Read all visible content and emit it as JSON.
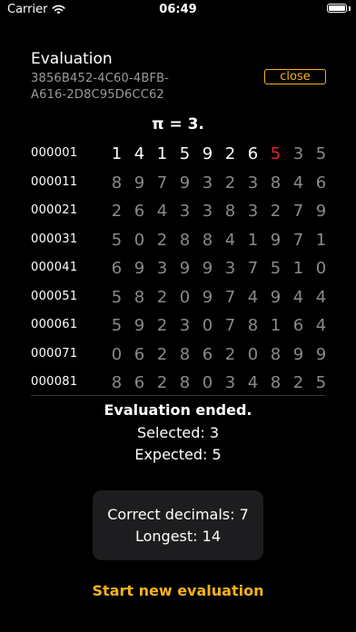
{
  "status_bar": {
    "carrier": "Carrier",
    "time": "06:49"
  },
  "header": {
    "title": "Evaluation",
    "evaluation_id": "3856B452-4C60-4BFB-A616-2D8C95D6CC62",
    "close_label": "close"
  },
  "pi_prefix": "π = 3.",
  "grid": {
    "rows": [
      {
        "label": "000001",
        "digits": [
          "1",
          "4",
          "1",
          "5",
          "9",
          "2",
          "6",
          "5",
          "3",
          "5"
        ]
      },
      {
        "label": "000011",
        "digits": [
          "8",
          "9",
          "7",
          "9",
          "3",
          "2",
          "3",
          "8",
          "4",
          "6"
        ]
      },
      {
        "label": "000021",
        "digits": [
          "2",
          "6",
          "4",
          "3",
          "3",
          "8",
          "3",
          "2",
          "7",
          "9"
        ]
      },
      {
        "label": "000031",
        "digits": [
          "5",
          "0",
          "2",
          "8",
          "8",
          "4",
          "1",
          "9",
          "7",
          "1"
        ]
      },
      {
        "label": "000041",
        "digits": [
          "6",
          "9",
          "3",
          "9",
          "9",
          "3",
          "7",
          "5",
          "1",
          "0"
        ]
      },
      {
        "label": "000051",
        "digits": [
          "5",
          "8",
          "2",
          "0",
          "9",
          "7",
          "4",
          "9",
          "4",
          "4"
        ]
      },
      {
        "label": "000061",
        "digits": [
          "5",
          "9",
          "2",
          "3",
          "0",
          "7",
          "8",
          "1",
          "6",
          "4"
        ]
      },
      {
        "label": "000071",
        "digits": [
          "0",
          "6",
          "2",
          "8",
          "6",
          "2",
          "0",
          "8",
          "9",
          "9"
        ]
      },
      {
        "label": "000081",
        "digits": [
          "8",
          "6",
          "2",
          "8",
          "0",
          "3",
          "4",
          "8",
          "2",
          "5"
        ]
      }
    ],
    "correct_count": 7,
    "wrong_index": 7
  },
  "result": {
    "title": "Evaluation ended.",
    "selected": "Selected: 3",
    "expected": "Expected: 5"
  },
  "summary": {
    "correct_decimals": "Correct decimals: 7",
    "longest": "Longest: 14"
  },
  "start_button_label": "Start new evaluation",
  "colors": {
    "accent": "#f4b21b",
    "wrong": "#e1242a",
    "correct": "#ffffff",
    "pending": "#8a8a8a"
  }
}
